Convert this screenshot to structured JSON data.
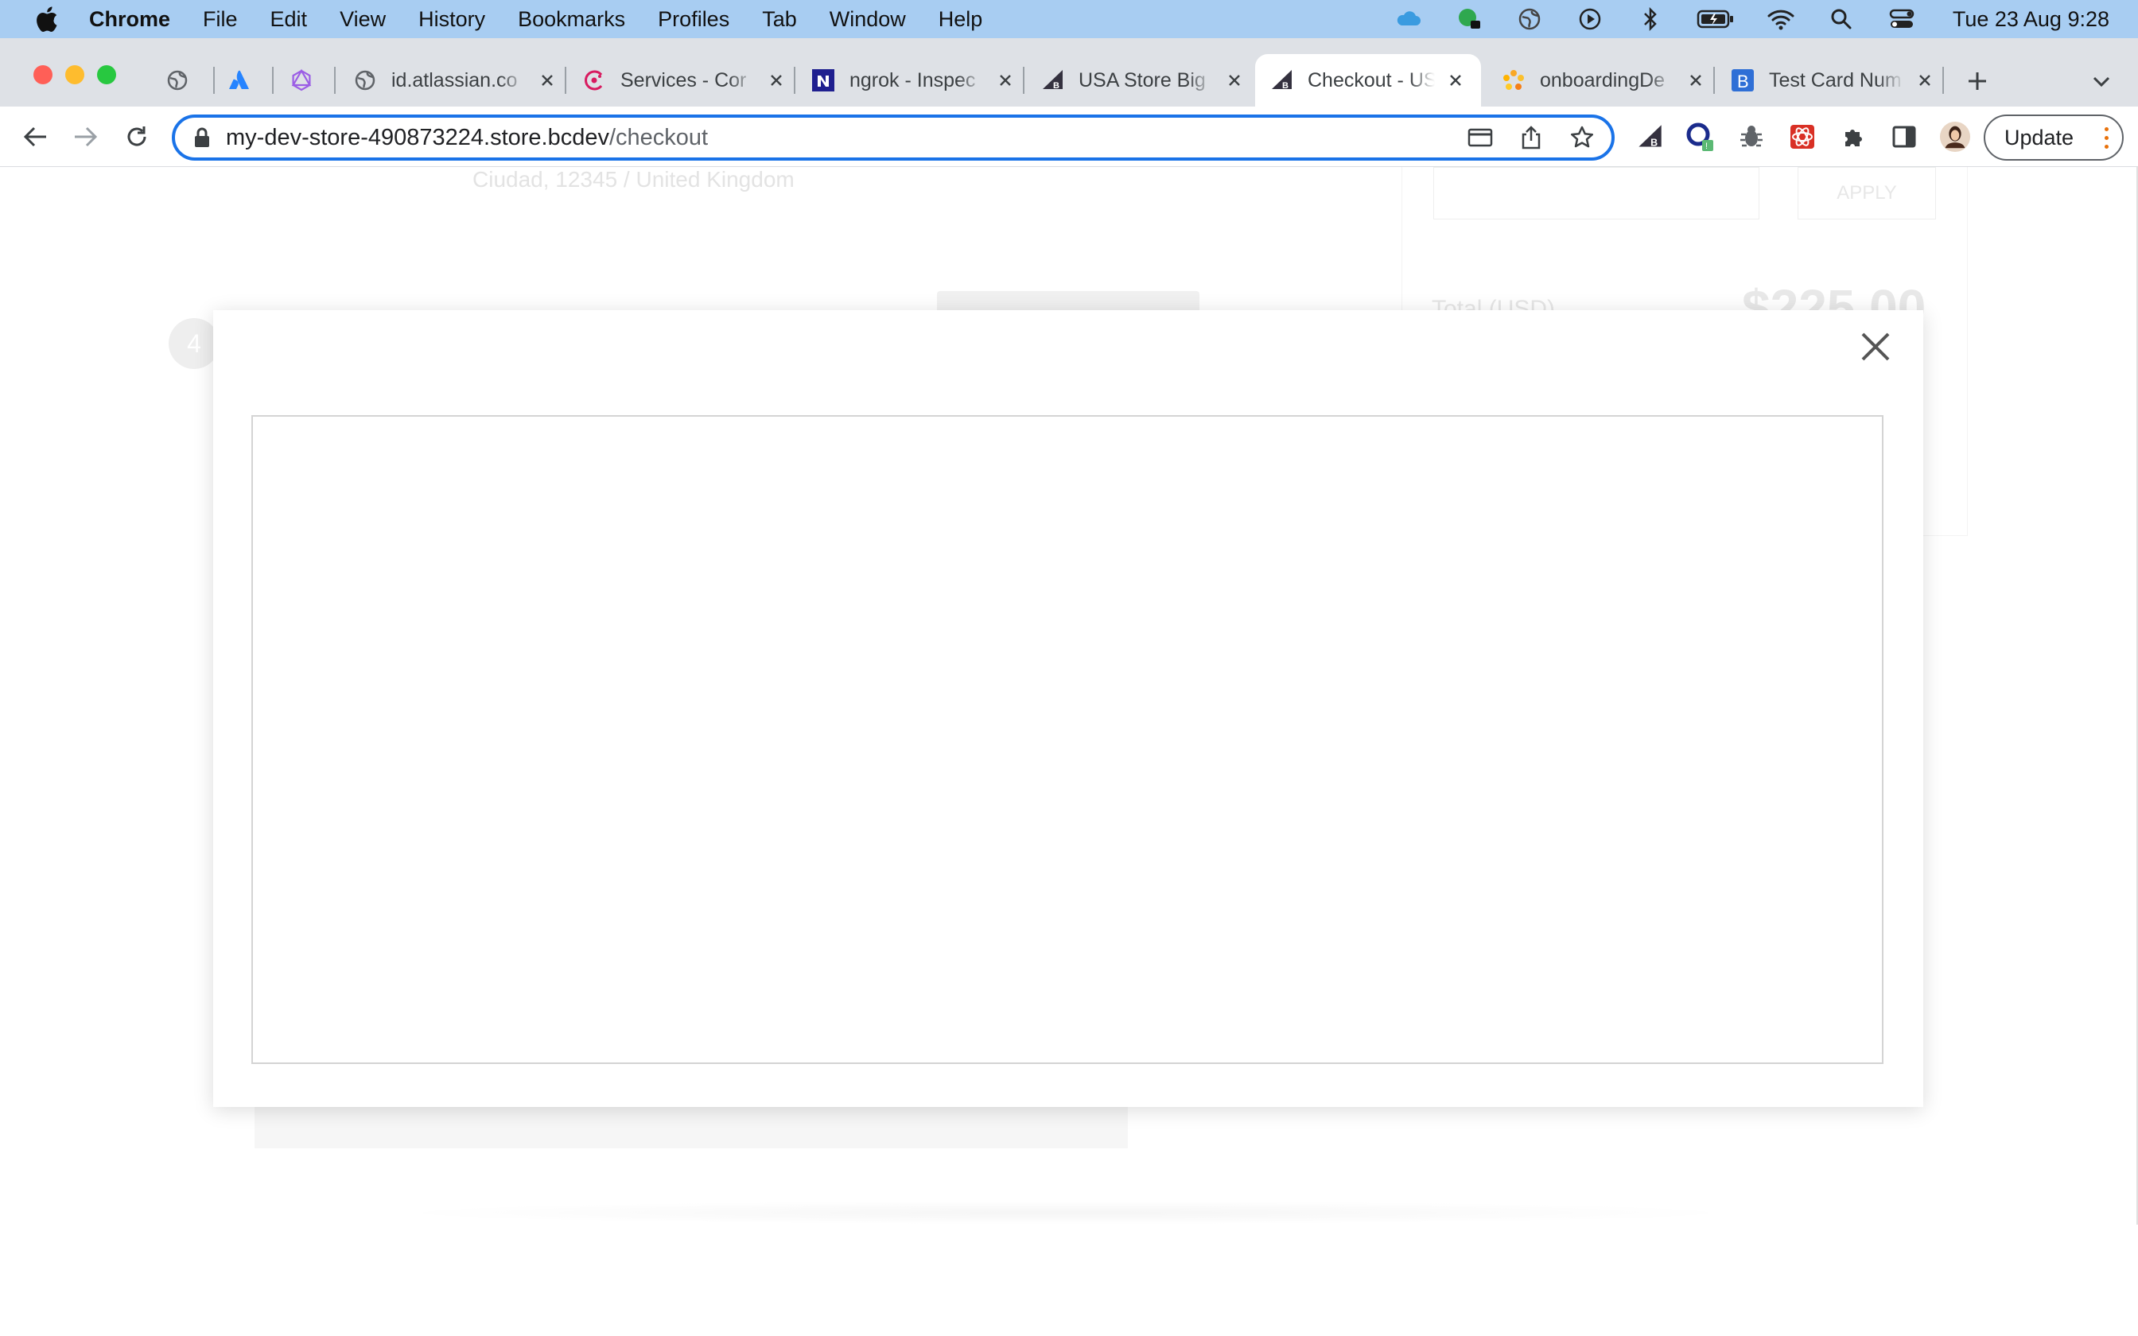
{
  "menubar": {
    "app_name": "Chrome",
    "items": [
      "File",
      "Edit",
      "View",
      "History",
      "Bookmarks",
      "Profiles",
      "Tab",
      "Window",
      "Help"
    ],
    "clock": "Tue 23 Aug  9:28",
    "status_icons": [
      "cloud-icon",
      "lock-app-icon",
      "globe-icon",
      "play-icon",
      "bluetooth-icon",
      "battery-icon",
      "wifi-icon",
      "search-icon",
      "control-center-icon"
    ]
  },
  "tabs": [
    {
      "title": "",
      "icon": "globe-icon"
    },
    {
      "title": "",
      "icon": "atlassian-icon"
    },
    {
      "title": "",
      "icon": "graphql-icon"
    },
    {
      "title": "id.atlassian.co",
      "icon": "globe-icon"
    },
    {
      "title": "Services - Cor",
      "icon": "services-icon"
    },
    {
      "title": "ngrok - Inspec",
      "icon": "ngrok-icon"
    },
    {
      "title": "USA Store Big",
      "icon": "bigcommerce-icon"
    },
    {
      "title": "Checkout - US",
      "icon": "bigcommerce-icon",
      "active": true
    },
    {
      "title": "onboardingDe",
      "icon": "onboarding-icon"
    },
    {
      "title": "Test Card Num",
      "icon": "b-icon"
    }
  ],
  "toolbar": {
    "url_host": "my-dev-store-490873224.store.bcdev",
    "url_path": "/checkout",
    "update_label": "Update"
  },
  "page": {
    "address_line": "Ciudad, 12345 / United Kingdom",
    "apply_label": "APPLY",
    "total_label": "Total (USD)",
    "total_value": "$225.00",
    "step_number": "4"
  },
  "colors": {
    "menubar_bg": "#a8cdf2",
    "tabbar_bg": "#dee1e6",
    "omnibox_focus": "#1a73e8",
    "traffic_red": "#ff5f57",
    "traffic_yellow": "#febc2e",
    "traffic_green": "#28c840"
  }
}
